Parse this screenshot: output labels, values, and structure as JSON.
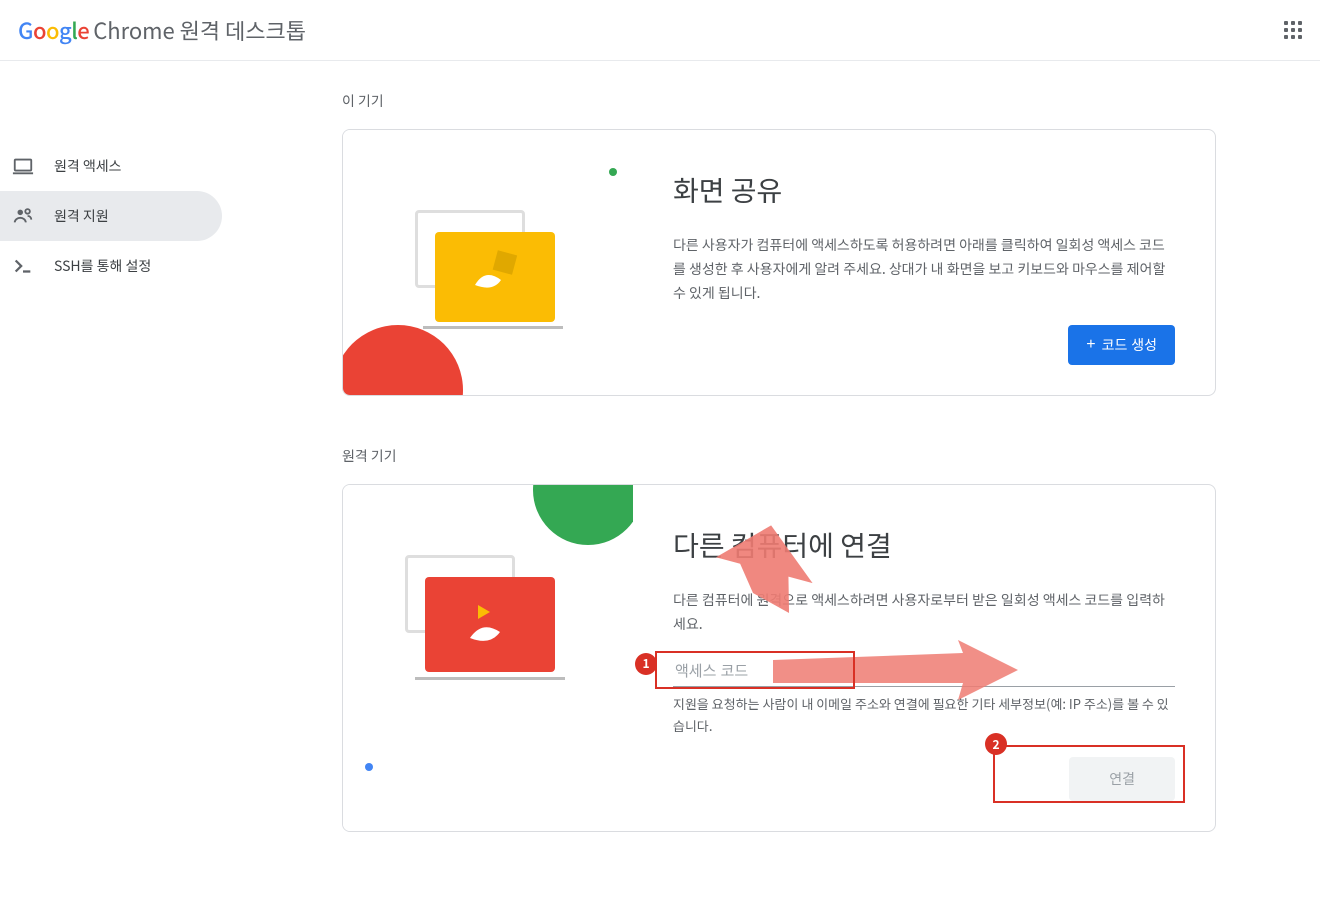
{
  "header": {
    "product_name": "Chrome 원격 데스크톱"
  },
  "sidebar": {
    "items": [
      {
        "label": "원격 액세스"
      },
      {
        "label": "원격 지원"
      },
      {
        "label": "SSH를 통해 설정"
      }
    ]
  },
  "sections": {
    "this_device": {
      "title": "이 기기",
      "card_title": "화면 공유",
      "card_desc": "다른 사용자가 컴퓨터에 액세스하도록 허용하려면 아래를 클릭하여 일회성 액세스 코드를 생성한 후 사용자에게 알려 주세요. 상대가 내 화면을 보고 키보드와 마우스를 제어할 수 있게 됩니다.",
      "button": "코드 생성"
    },
    "remote_device": {
      "title": "원격 기기",
      "card_title": "다른 컴퓨터에 연결",
      "card_desc": "다른 컴퓨터에 원격으로 액세스하려면 사용자로부터 받은 일회성 액세스 코드를 입력하세요.",
      "input_placeholder": "액세스 코드",
      "hint": "지원을 요청하는 사람이 내 이메일 주소와 연결에 필요한 기타 세부정보(예: IP 주소)를 볼 수 있습니다.",
      "button": "연결"
    }
  },
  "annotations": {
    "marker1": "1",
    "marker2": "2"
  }
}
